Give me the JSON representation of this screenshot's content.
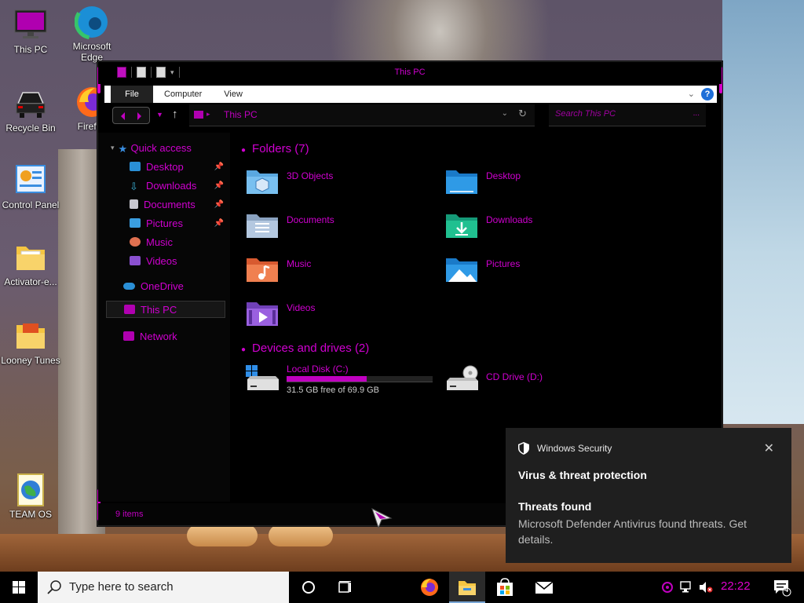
{
  "desktop": {
    "icons": [
      {
        "label": "This PC"
      },
      {
        "label": "Microsoft Edge"
      },
      {
        "label": "Recycle Bin"
      },
      {
        "label": "Firefox"
      },
      {
        "label": "Control Panel"
      },
      {
        "label": "Activator-e..."
      },
      {
        "label": "Looney Tunes"
      },
      {
        "label": "TEAM OS"
      }
    ]
  },
  "explorer": {
    "title": "This PC",
    "ribbon_tabs": [
      "File",
      "Computer",
      "View"
    ],
    "address_path": "This PC",
    "search_placeholder": "Search This PC",
    "search_dots": "...",
    "nav": {
      "quick_access": "Quick access",
      "desktop": "Desktop",
      "downloads": "Downloads",
      "documents": "Documents",
      "pictures": "Pictures",
      "music": "Music",
      "videos": "Videos",
      "onedrive": "OneDrive",
      "this_pc": "This PC",
      "network": "Network"
    },
    "folders_heading": "Folders (7)",
    "folders": [
      "3D Objects",
      "Desktop",
      "Documents",
      "Downloads",
      "Music",
      "Pictures",
      "Videos"
    ],
    "drives_heading": "Devices and drives (2)",
    "drives": [
      {
        "name": "Local Disk (C:)",
        "free": "31.5 GB free of 69.9 GB",
        "used_fraction": 0.55
      },
      {
        "name": "CD Drive (D:)"
      }
    ],
    "status_count": "9 items"
  },
  "toast": {
    "source": "Windows Security",
    "title": "Virus & threat protection",
    "subtitle": "Threats found",
    "message": "Microsoft Defender Antivirus found threats. Get details."
  },
  "taskbar": {
    "search_placeholder": "Type here to search",
    "time": "22:22",
    "notification_count": "4"
  },
  "colors": {
    "accent": "#d000d0",
    "toast_bg": "#1f1f1f",
    "taskbar_bg": "#000000"
  }
}
